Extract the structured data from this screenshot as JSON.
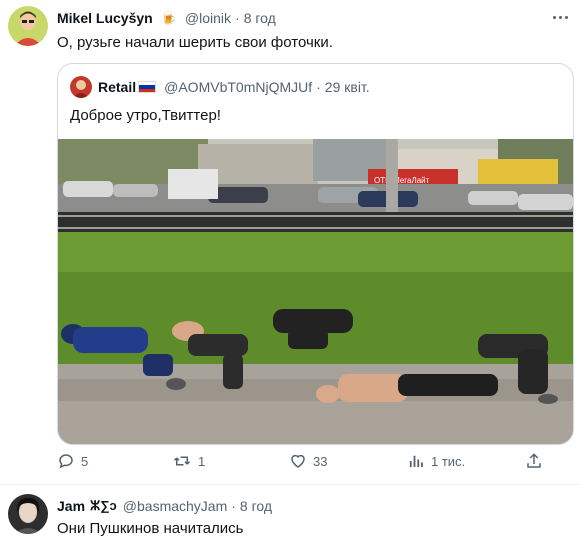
{
  "tweet": {
    "author_name": "Mikel Lucyšyn",
    "author_badge": "🍺",
    "handle": "@loinik",
    "separator": "·",
    "time": "8 год",
    "text": "О, рузьге начали шерить свои фоточки."
  },
  "quote": {
    "author_name": "Retail",
    "handle": "@AOMVbT0mNjQMJUf",
    "separator": "·",
    "time": "29 квіт.",
    "text": "Доброе утро,Твиттер!"
  },
  "photo_sign": {
    "shop_name": "ОТП МегаЛайт"
  },
  "actions": {
    "replies": "5",
    "retweets": "1",
    "likes": "33",
    "views": "1 тис."
  },
  "reply": {
    "author_name": "Jam",
    "author_badge": "ⵣ∑ↄ",
    "handle": "@basmachyJam",
    "separator": "·",
    "time": "8 год",
    "text": "Они Пушкинов начитались"
  },
  "colors": {
    "text": "#0f1419",
    "secondary": "#536471",
    "border": "#cfd9de"
  }
}
